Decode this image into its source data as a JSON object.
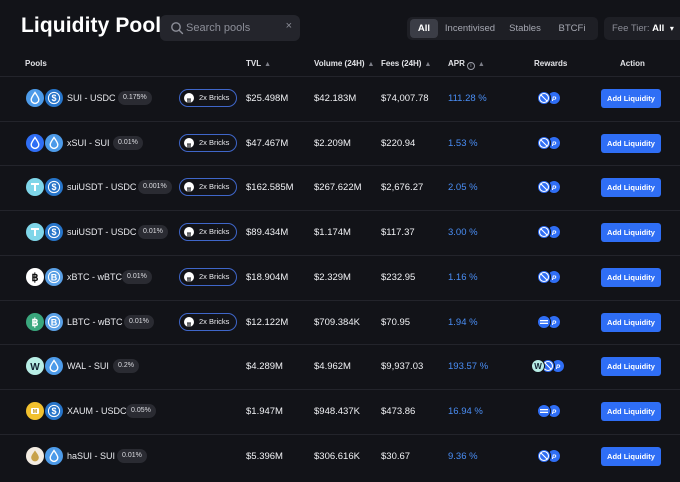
{
  "title": "Liquidity Pools",
  "search": {
    "placeholder": "Search pools",
    "value": "",
    "clear_glyph": "×"
  },
  "filters": [
    "All",
    "Incentivised",
    "Stables",
    "BTCFi"
  ],
  "active_filter": "All",
  "fee_tier": {
    "label": "Fee Tier:",
    "value": "All"
  },
  "columns": {
    "pools": "Pools",
    "tvl": "TVL",
    "volume": "Volume (24H)",
    "fees": "Fees (24H)",
    "apr": "APR",
    "rewards": "Rewards",
    "action": "Action"
  },
  "colors": {
    "background": "#121318",
    "accent": "#2f6ef5",
    "apr_text": "#4a8ef5",
    "bricks_border": "#3f66c9"
  },
  "rows": [
    {
      "pair": "SUI - USDC",
      "fee": "0.175%",
      "bricks": "2x Bricks",
      "tvl": "$25.498M",
      "volume": "$42.183M",
      "fees": "$74,007.78",
      "apr": "111.28 %",
      "tokens": [
        "sui-icon",
        "usdc-icon"
      ],
      "rewards": [
        "sui-reward-icon",
        "points-reward-icon"
      ],
      "action": "Add Liquidity"
    },
    {
      "pair": "xSUI - SUI",
      "fee": "0.01%",
      "bricks": "2x Bricks",
      "tvl": "$47.467M",
      "volume": "$2.209M",
      "fees": "$220.94",
      "apr": "1.53 %",
      "tokens": [
        "xsui-icon",
        "sui-icon"
      ],
      "rewards": [
        "sui-reward-icon",
        "points-reward-icon"
      ],
      "action": "Add Liquidity"
    },
    {
      "pair": "suiUSDT - USDC",
      "fee": "0.001%",
      "bricks": "2x Bricks",
      "tvl": "$162.585M",
      "volume": "$267.622M",
      "fees": "$2,676.27",
      "apr": "2.05 %",
      "tokens": [
        "usdt-icon",
        "usdc-icon"
      ],
      "rewards": [
        "sui-reward-icon",
        "points-reward-icon"
      ],
      "action": "Add Liquidity"
    },
    {
      "pair": "suiUSDT - USDC",
      "fee": "0.01%",
      "bricks": "2x Bricks",
      "tvl": "$89.434M",
      "volume": "$1.174M",
      "fees": "$117.37",
      "apr": "3.00 %",
      "tokens": [
        "usdt-icon",
        "usdc-icon"
      ],
      "rewards": [
        "sui-reward-icon",
        "points-reward-icon"
      ],
      "action": "Add Liquidity"
    },
    {
      "pair": "xBTC - wBTC",
      "fee": "0.01%",
      "bricks": "2x Bricks",
      "tvl": "$18.904M",
      "volume": "$2.329M",
      "fees": "$232.95",
      "apr": "1.16 %",
      "tokens": [
        "xbtc-icon",
        "wbtc-icon"
      ],
      "rewards": [
        "sui-reward-icon",
        "points-reward-icon"
      ],
      "action": "Add Liquidity"
    },
    {
      "pair": "LBTC - wBTC",
      "fee": "0.01%",
      "bricks": "2x Bricks",
      "tvl": "$12.122M",
      "volume": "$709.384K",
      "fees": "$70.95",
      "apr": "1.94 %",
      "tokens": [
        "lbtc-icon",
        "wbtc-icon"
      ],
      "rewards": [
        "lombard-reward-icon",
        "points-reward-icon"
      ],
      "action": "Add Liquidity"
    },
    {
      "pair": "WAL - SUI",
      "fee": "0.2%",
      "bricks": "",
      "tvl": "$4.289M",
      "volume": "$4.962M",
      "fees": "$9,937.03",
      "apr": "193.57 %",
      "tokens": [
        "wal-icon",
        "sui-icon"
      ],
      "rewards": [
        "wal-reward-icon",
        "sui-reward-icon",
        "points-reward-icon"
      ],
      "action": "Add Liquidity"
    },
    {
      "pair": "XAUM - USDC",
      "fee": "0.05%",
      "bricks": "",
      "tvl": "$1.947M",
      "volume": "$948.437K",
      "fees": "$473.86",
      "apr": "16.94 %",
      "tokens": [
        "xaum-icon",
        "usdc-icon"
      ],
      "rewards": [
        "lombard-reward-icon",
        "points-reward-icon"
      ],
      "action": "Add Liquidity"
    },
    {
      "pair": "haSUI - SUI",
      "fee": "0.01%",
      "bricks": "",
      "tvl": "$5.396M",
      "volume": "$306.616K",
      "fees": "$30.67",
      "apr": "9.36 %",
      "tokens": [
        "hasui-icon",
        "sui-icon"
      ],
      "rewards": [
        "sui-reward-icon",
        "points-reward-icon"
      ],
      "action": "Add Liquidity"
    }
  ]
}
